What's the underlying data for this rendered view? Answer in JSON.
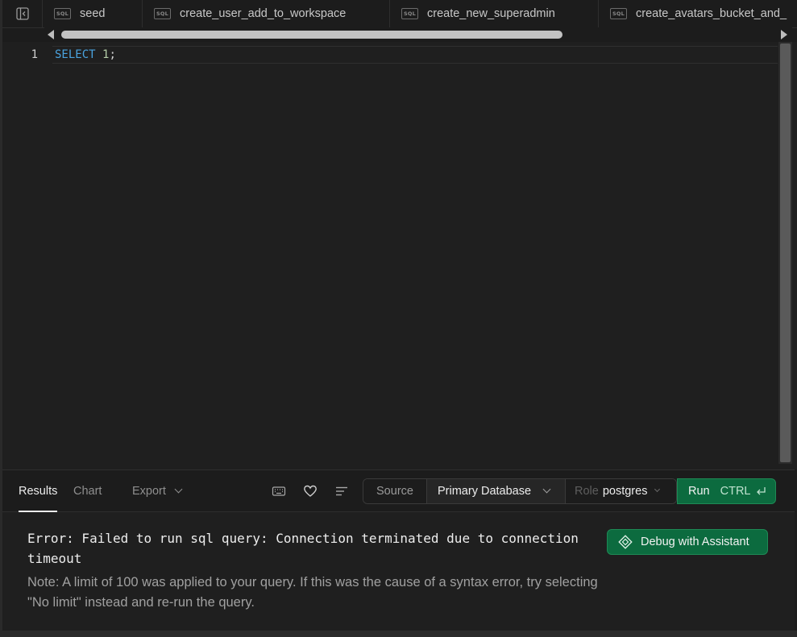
{
  "tabs": [
    {
      "badge": "SQL",
      "label": "seed"
    },
    {
      "badge": "SQL",
      "label": "create_user_add_to_workspace"
    },
    {
      "badge": "SQL",
      "label": "create_new_superadmin"
    },
    {
      "badge": "SQL",
      "label": "create_avatars_bucket_and_"
    }
  ],
  "editor": {
    "line_number": "1",
    "code": {
      "keyword": "SELECT",
      "number": "1",
      "punct": ";"
    }
  },
  "toolbar": {
    "tabs": {
      "results": "Results",
      "chart": "Chart",
      "export": "Export"
    },
    "active_tab": "Results",
    "icons": [
      "keyboard-icon",
      "heart-icon",
      "align-left-icon"
    ],
    "source_label": "Source",
    "database": "Primary Database",
    "role_label": "Role",
    "role_value": "postgres",
    "run_label": "Run",
    "run_shortcut": "CTRL"
  },
  "results": {
    "error": "Error: Failed to run sql query: Connection terminated due to connection timeout",
    "note": "Note: A limit of 100 was applied to your query. If this was the cause of a syntax error, try selecting \"No limit\" instead and re-run the query.",
    "debug_label": "Debug with Assistant"
  },
  "colors": {
    "background": "#1c1c1c",
    "brand_green": "#0c6b3f",
    "keyword_blue": "#4aa3df"
  }
}
